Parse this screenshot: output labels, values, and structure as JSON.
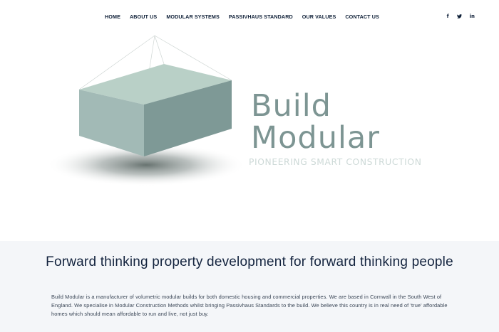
{
  "nav": {
    "items": [
      {
        "label": "HOME"
      },
      {
        "label": "ABOUT US"
      },
      {
        "label": "MODULAR SYSTEMS"
      },
      {
        "label": "PASSIVHAUS STANDARD"
      },
      {
        "label": "OUR VALUES"
      },
      {
        "label": "CONTACT US"
      }
    ],
    "social": [
      {
        "icon": "facebook-icon",
        "glyph": "f"
      },
      {
        "icon": "twitter-icon",
        "glyph": ""
      },
      {
        "icon": "linkedin-icon",
        "glyph": "in"
      }
    ]
  },
  "hero": {
    "logo_line1": "Build",
    "logo_line2": "Modular",
    "tagline": "PIONEERING SMART CONSTRUCTION",
    "colors": {
      "box_top": "#b9d0c7",
      "box_front": "#a2bab6",
      "box_side": "#7e9996",
      "logo_text": "#7d9593",
      "tagline": "#cdd9d7"
    }
  },
  "intro": {
    "heading": "Forward thinking property development for forward thinking people",
    "body": "Build Modular is a manufacturer of volumetric modular builds for both domestic housing and commercial properties. We are based in Cornwall in the South West of England. We specialise in Modular Construction Methods whilst bringing Passivhaus Standards to the build. We believe this country is in real need of 'true' affordable homes which should mean affordable to run and live, not just buy.",
    "background": "#f4f6f9"
  }
}
